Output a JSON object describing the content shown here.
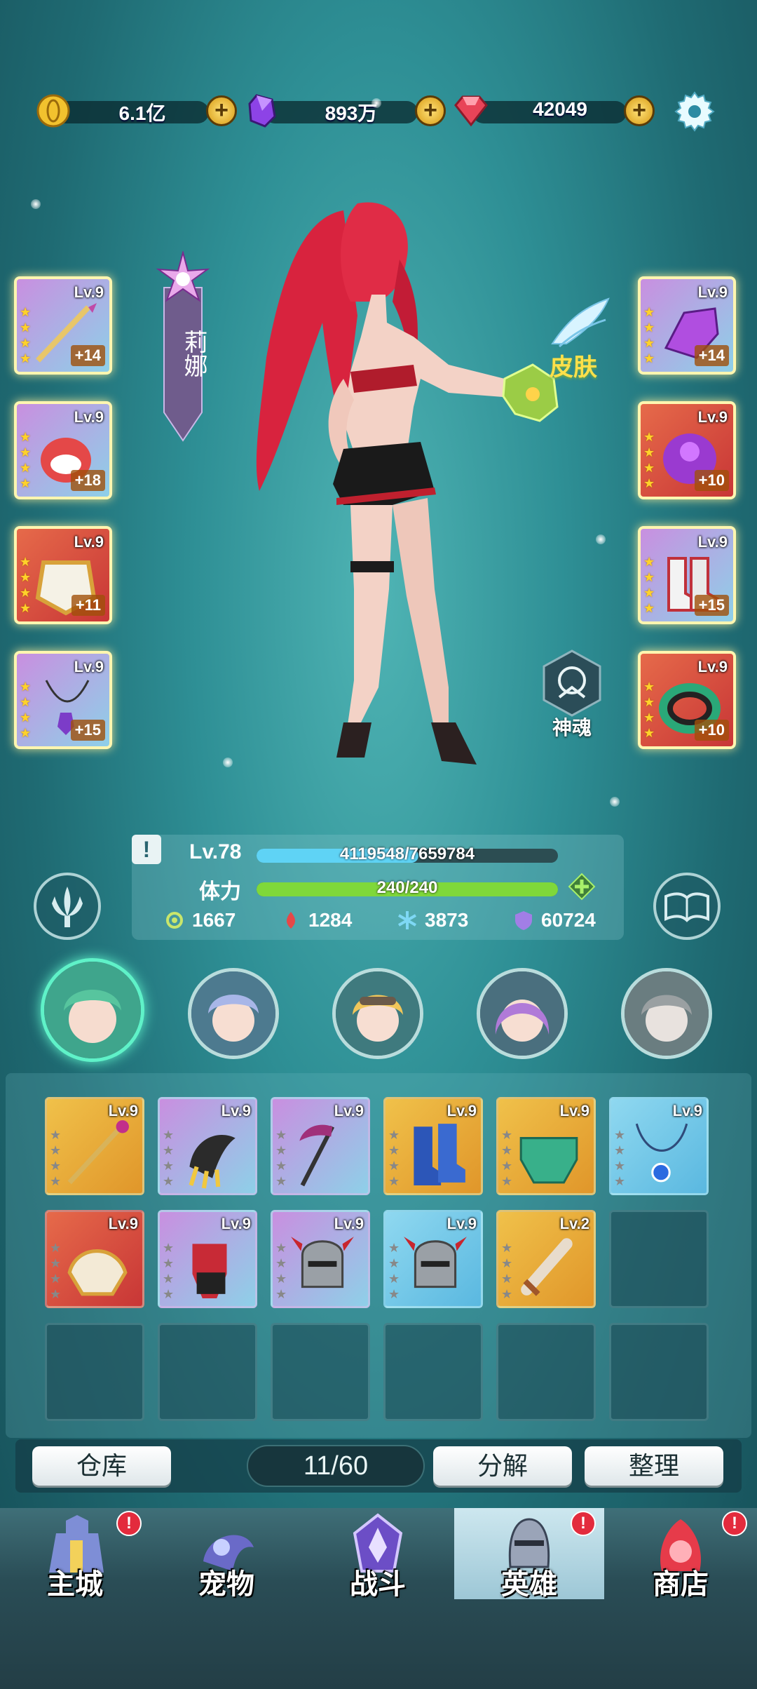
{
  "currencies": [
    {
      "name": "gold-coin",
      "value": "6.1亿"
    },
    {
      "name": "purple-crystal",
      "value": "893万"
    },
    {
      "name": "red-gem",
      "value": "42049"
    }
  ],
  "hero": {
    "name": "莉娜",
    "skin_label": "皮肤",
    "soul_label": "神魂",
    "level_label": "Lv.78",
    "exp_text": "4119548/7659784",
    "exp_progress": 0.538,
    "stamina_label": "体力",
    "stamina_text": "240/240",
    "stamina_progress": 1.0,
    "stats": [
      "1667",
      "1284",
      "3873",
      "60724"
    ]
  },
  "equipped_left": [
    {
      "lv": "Lv.9",
      "plus": "+14",
      "icon": "golden-spear-icon"
    },
    {
      "lv": "Lv.9",
      "plus": "+18",
      "icon": "red-helmet-icon"
    },
    {
      "lv": "Lv.9",
      "plus": "+11",
      "icon": "gold-armor-icon"
    },
    {
      "lv": "Lv.9",
      "plus": "+15",
      "icon": "amulet-icon"
    }
  ],
  "equipped_right": [
    {
      "lv": "Lv.9",
      "plus": "+14",
      "icon": "purple-gauntlet-icon"
    },
    {
      "lv": "Lv.9",
      "plus": "+10",
      "icon": "purple-armor-icon"
    },
    {
      "lv": "Lv.9",
      "plus": "+15",
      "icon": "boots-icon"
    },
    {
      "lv": "Lv.9",
      "plus": "+10",
      "icon": "green-bracer-icon"
    }
  ],
  "inventory": [
    {
      "lv": "Lv.9",
      "icon": "staff-icon",
      "bg": "orange"
    },
    {
      "lv": "Lv.9",
      "icon": "claw-icon",
      "bg": "purple"
    },
    {
      "lv": "Lv.9",
      "icon": "scythe-icon",
      "bg": "purple"
    },
    {
      "lv": "Lv.9",
      "icon": "blue-boots-icon",
      "bg": "orange"
    },
    {
      "lv": "Lv.9",
      "icon": "green-belt-icon",
      "bg": "orange"
    },
    {
      "lv": "Lv.9",
      "icon": "blue-necklace-icon",
      "bg": "blue"
    },
    {
      "lv": "Lv.9",
      "icon": "gold-helm-icon",
      "bg": "red"
    },
    {
      "lv": "Lv.9",
      "icon": "red-gauntlet-icon",
      "bg": "purple"
    },
    {
      "lv": "Lv.9",
      "icon": "horned-helmet-icon",
      "bg": "purple"
    },
    {
      "lv": "Lv.9",
      "icon": "horned-helmet-icon",
      "bg": "blue"
    },
    {
      "lv": "Lv.2",
      "icon": "sword-icon",
      "bg": "orange"
    }
  ],
  "actions": {
    "warehouse": "仓库",
    "counter": "11/60",
    "decompose": "分解",
    "sort": "整理"
  },
  "nav": [
    {
      "label": "主城",
      "badge": "!"
    },
    {
      "label": "宠物",
      "badge": ""
    },
    {
      "label": "战斗",
      "badge": ""
    },
    {
      "label": "英雄",
      "badge": "!",
      "active": true
    },
    {
      "label": "商店",
      "badge": "!"
    }
  ],
  "colors": {
    "exp_bar": "#5fd3f5",
    "stamina_bar": "#7fd83a",
    "gold_plus": "#e9b21f",
    "badge_red": "#e32b3d"
  }
}
